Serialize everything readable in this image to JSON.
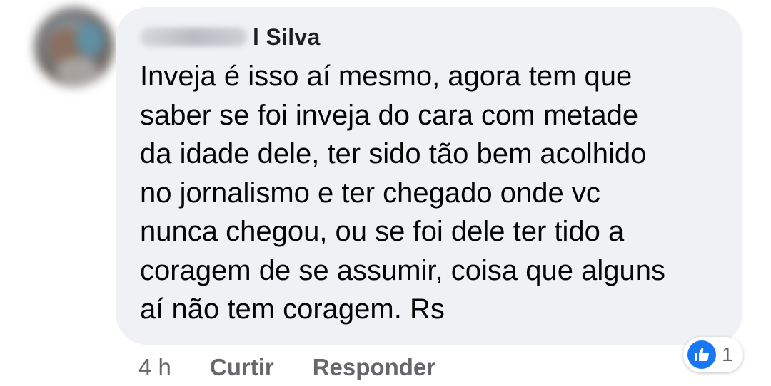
{
  "comment": {
    "author_visible": "l Silva",
    "lines": [
      "Inveja é isso aí mesmo, agora tem que",
      "saber se foi inveja do cara com metade",
      "da idade dele, ter sido tão bem acolhido",
      "no jornalismo e ter chegado onde vc",
      "nunca chegou, ou se foi dele ter tido a",
      "coragem de se assumir, coisa que alguns",
      "aí não tem coragem. Rs"
    ]
  },
  "actions": {
    "time": "4 h",
    "like_label": "Curtir",
    "reply_label": "Responder"
  },
  "reaction": {
    "icon": "like-thumb-icon",
    "count": "1",
    "color": "#1877f2"
  },
  "colors": {
    "bubble": "#eff1f5",
    "text": "#050505",
    "secondary": "#65676b"
  }
}
